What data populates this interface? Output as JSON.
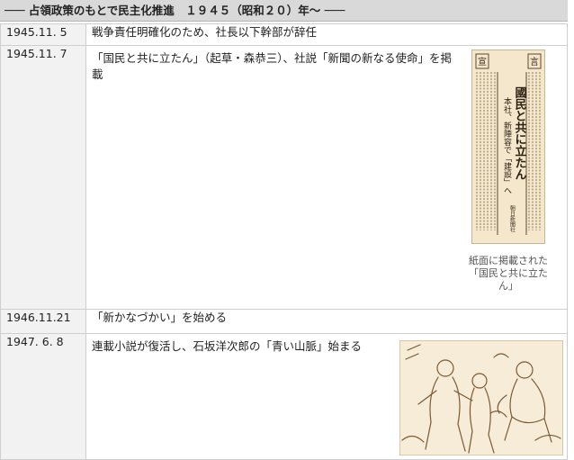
{
  "header": {
    "title": "─── 占領政策のもとで民主化推進　１９４５（昭和２０）年～ ───"
  },
  "rows": [
    {
      "date": "1945.11. 5",
      "text": "戦争責任明確化のため、社長以下幹部が辞任"
    },
    {
      "date": "1945.11. 7",
      "text": "「国民と共に立たん」（起草・森恭三）、社説「新聞の新なる使命」を掲載",
      "figure": {
        "headline": "國民と共に立たん",
        "sub": "本社、新陣容で「建設」へ",
        "corner_left": "宣",
        "corner_right": "言",
        "footer": "朝日新聞社",
        "caption": "紙面に掲載された「国民と共に立たん」"
      }
    },
    {
      "date": "1946.11.21",
      "text": "「新かなづかい」を始める"
    },
    {
      "date": "1947. 6. 8",
      "text": "連載小説が復活し、石坂洋次郎の「青い山脈」始まる"
    }
  ]
}
